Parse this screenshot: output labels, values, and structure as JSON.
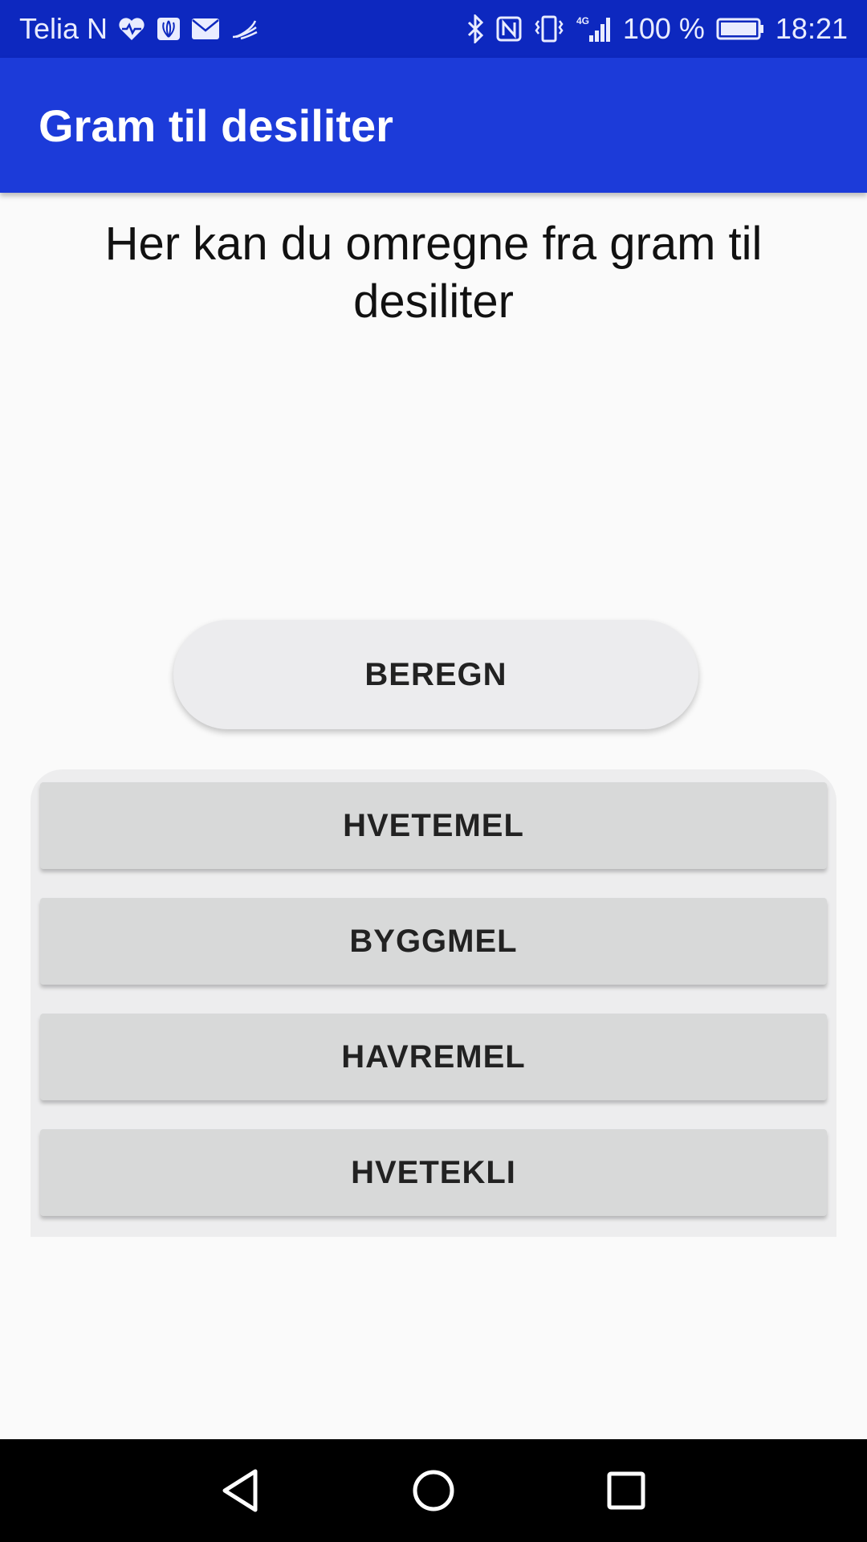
{
  "status_bar": {
    "carrier": "Telia N",
    "battery_percent": "100 %",
    "time": "18:21",
    "icons_left": [
      "heart-monitor-icon",
      "huawei-app-icon",
      "mail-icon",
      "swype-icon"
    ],
    "icons_right": [
      "bluetooth-icon",
      "nfc-icon",
      "vibrate-icon",
      "signal-4g-icon",
      "battery-icon"
    ]
  },
  "app_bar": {
    "title": "Gram til desiliter",
    "color": "#1c3bd9"
  },
  "main": {
    "intro_text": "Her kan du omregne fra gram til desiliter",
    "beregn_label": "BEREGN",
    "options": [
      {
        "label": "HVETEMEL"
      },
      {
        "label": "BYGGMEL"
      },
      {
        "label": "HAVREMEL"
      },
      {
        "label": "HVETEKLI"
      }
    ]
  },
  "nav_bar": {
    "icons": [
      "back-icon",
      "home-icon",
      "recents-icon"
    ]
  },
  "colors": {
    "status_bar": "#0d28bf",
    "app_bar": "#1c3bd9",
    "background": "#fafafa",
    "button": "#d8d9d9"
  }
}
